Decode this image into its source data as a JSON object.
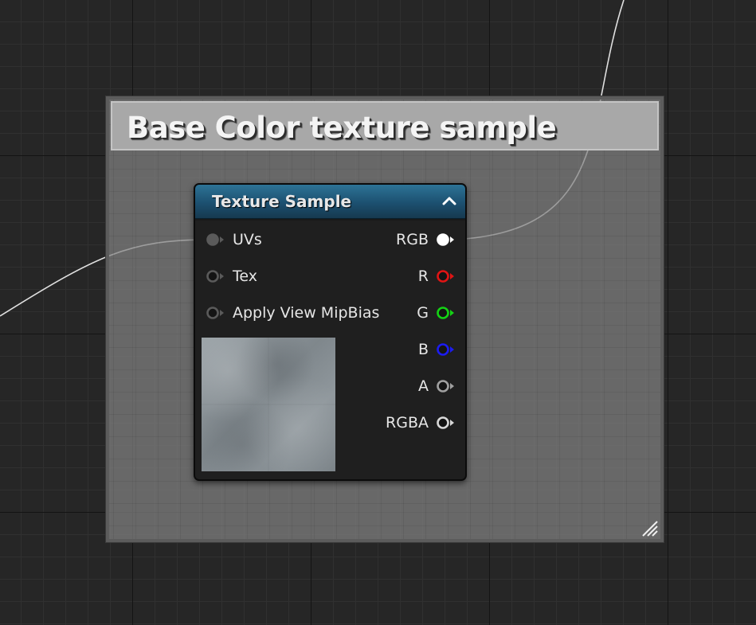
{
  "comment": {
    "title": "Base Color texture sample"
  },
  "node": {
    "title": "Texture Sample",
    "inputs": [
      {
        "label": "UVs",
        "connected": true,
        "color": "#5a5a5a"
      },
      {
        "label": "Tex",
        "connected": false,
        "color": "#5a5a5a"
      },
      {
        "label": "Apply View MipBias",
        "connected": false,
        "color": "#5a5a5a"
      }
    ],
    "outputs": [
      {
        "label": "RGB",
        "connected": true,
        "color": "#ffffff"
      },
      {
        "label": "R",
        "connected": false,
        "color": "#e01414"
      },
      {
        "label": "G",
        "connected": false,
        "color": "#14d214"
      },
      {
        "label": "B",
        "connected": false,
        "color": "#1c1cf0"
      },
      {
        "label": "A",
        "connected": false,
        "color": "#a0a0a0"
      },
      {
        "label": "RGBA",
        "connected": false,
        "color": "#d8d8d8"
      }
    ]
  },
  "colors": {
    "header_top": "#2d7396",
    "header_bottom": "#16394f",
    "wire": "#e0e0e0"
  }
}
